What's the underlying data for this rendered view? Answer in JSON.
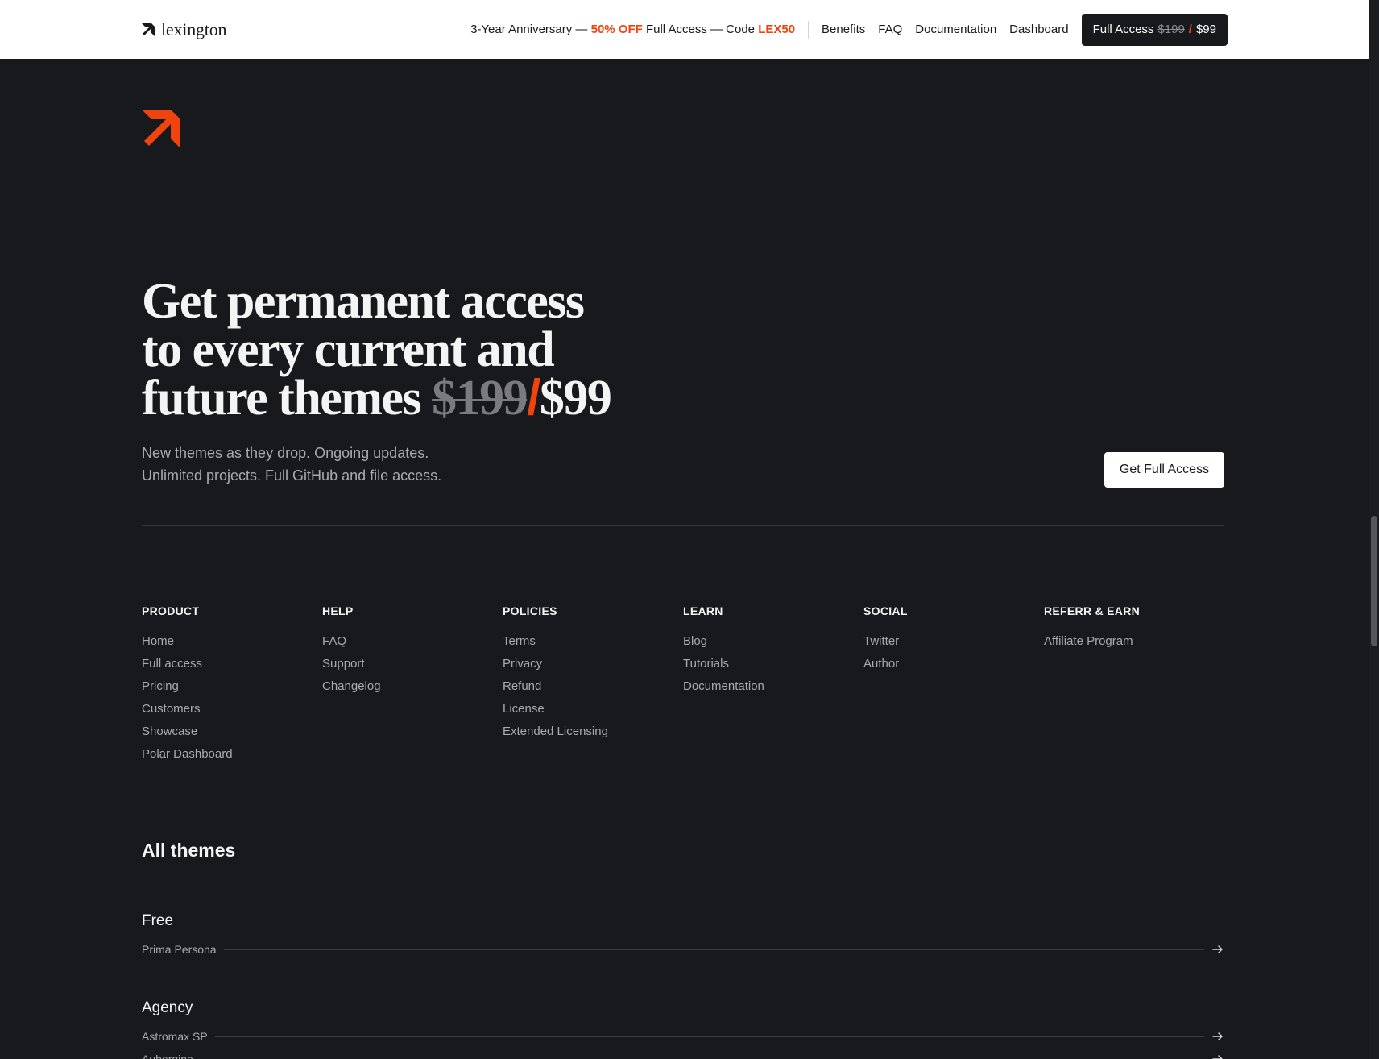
{
  "nav": {
    "brand": "lexington",
    "promo": {
      "prefix": "3-Year Anniversary — ",
      "discount": "50% OFF",
      "middle": " Full Access — Code ",
      "code": "LEX50"
    },
    "links": [
      "Benefits",
      "FAQ",
      "Documentation",
      "Dashboard"
    ],
    "cta": {
      "label": "Full Access",
      "old_price": "$199",
      "slash": "/",
      "new_price": "$99"
    }
  },
  "hero": {
    "title_line1": "Get permanent access",
    "title_line2": "to every current and",
    "title_line3_prefix": "future themes ",
    "old_price": "$199",
    "slash": "/",
    "new_price": "$99",
    "subtitle_line1": "New themes as they drop. Ongoing updates.",
    "subtitle_line2": "Unlimited projects. Full GitHub and file access.",
    "cta": "Get Full Access"
  },
  "footer": {
    "columns": [
      {
        "title": "PRODUCT",
        "items": [
          "Home",
          "Full access",
          "Pricing",
          "Customers",
          "Showcase",
          "Polar Dashboard"
        ]
      },
      {
        "title": "HELP",
        "items": [
          "FAQ",
          "Support",
          "Changelog"
        ]
      },
      {
        "title": "POLICIES",
        "items": [
          "Terms",
          "Privacy",
          "Refund",
          "License",
          "Extended Licensing"
        ]
      },
      {
        "title": "LEARN",
        "items": [
          "Blog",
          "Tutorials",
          "Documentation"
        ]
      },
      {
        "title": "SOCIAL",
        "items": [
          "Twitter",
          "Author"
        ]
      },
      {
        "title": "REFERR & EARN",
        "items": [
          "Affiliate Program"
        ]
      }
    ]
  },
  "themes": {
    "title": "All themes",
    "groups": [
      {
        "title": "Free",
        "items": [
          "Prima Persona"
        ]
      },
      {
        "title": "Agency",
        "items": [
          "Astromax SP",
          "Aubergine"
        ]
      }
    ]
  },
  "colors": {
    "accent": "#f0440f",
    "background": "#18191d",
    "nav_bg": "#ffffff"
  },
  "icons": {
    "brand": "lexington-arrow-logo-icon",
    "row_arrow": "arrow-right-icon"
  }
}
